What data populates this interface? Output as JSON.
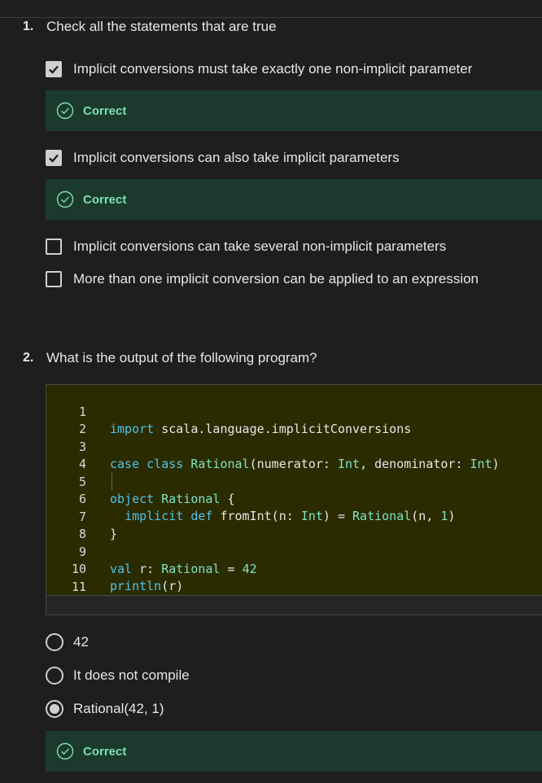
{
  "q1": {
    "number": "1.",
    "text": "Check all the statements that are true",
    "options": [
      {
        "label": "Implicit conversions must take exactly one non-implicit parameter",
        "checked": true,
        "feedback": "Correct"
      },
      {
        "label": "Implicit conversions can also take implicit parameters",
        "checked": true,
        "feedback": "Correct"
      },
      {
        "label": "Implicit conversions can take several non-implicit parameters",
        "checked": false
      },
      {
        "label": "More than one implicit conversion can be applied to an expression",
        "checked": false
      }
    ]
  },
  "q2": {
    "number": "2.",
    "text": "What is the output of the following program?",
    "line_numbers": [
      "1",
      "2",
      "3",
      "4",
      "5",
      "6",
      "7",
      "8",
      "9",
      "10",
      "11"
    ],
    "code": {
      "l1_kw": "import",
      "l1_rest": " scala.language.implicitConversions",
      "l3_kw1": "case",
      "l3_kw2": "class",
      "l3_ty": "Rational",
      "l3_a": "(numerator: ",
      "l3_ty2": "Int",
      "l3_b": ", denominator: ",
      "l3_ty3": "Int",
      "l3_c": ")",
      "l5_kw": "object",
      "l5_ty": "Rational",
      "l5_rest": " {",
      "l6_kw1": "implicit",
      "l6_kw2": "def",
      "l6_a": " fromInt(n: ",
      "l6_ty": "Int",
      "l6_b": ") = ",
      "l6_ty2": "Rational",
      "l6_c": "(n, ",
      "l6_num": "1",
      "l6_d": ")",
      "l7": "}",
      "l9_kw": "val",
      "l9_a": " r: ",
      "l9_ty": "Rational",
      "l9_b": " = ",
      "l9_num": "42",
      "l10_kw": "println",
      "l10_rest": "(r)"
    },
    "options": [
      {
        "label": "42",
        "selected": false
      },
      {
        "label": "It does not compile",
        "selected": false
      },
      {
        "label": "Rational(42, 1)",
        "selected": true,
        "feedback": "Correct"
      }
    ]
  },
  "colors": {
    "background": "#1e1e1e",
    "correct_bg": "#1b3a2d",
    "correct_text": "#7ce0b4",
    "editor_bg": "#2b2b00",
    "keyword": "#4fc3e8",
    "type": "#7fe3c4"
  },
  "icons": {
    "checkbox_checked": "checkmark-icon",
    "feedback": "check-circle-icon"
  }
}
